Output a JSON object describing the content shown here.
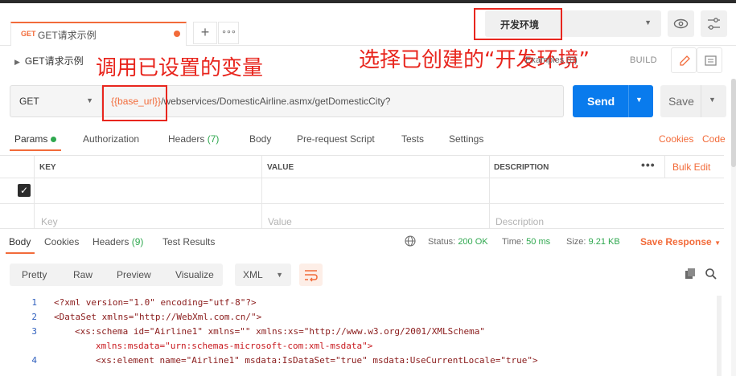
{
  "tab": {
    "method": "GET",
    "name": "GET请求示例"
  },
  "environment": {
    "selected": "开发环境"
  },
  "request": {
    "title": "GET请求示例",
    "examples_label": "Examples",
    "examples_count": "0",
    "build_label": "BUILD",
    "method": "GET",
    "url_var": "{{base_url}}",
    "url_rest": "/webservices/DomesticAirline.asmx/getDomesticCity?",
    "send_label": "Send",
    "save_label": "Save"
  },
  "annotations": {
    "left": "调用已设置的变量",
    "right": "选择已创建的“开发环境”"
  },
  "request_tabs": {
    "params": "Params",
    "authorization": "Authorization",
    "headers": "Headers",
    "headers_count": "(7)",
    "body": "Body",
    "prerequest": "Pre-request Script",
    "tests": "Tests",
    "settings": "Settings",
    "cookies": "Cookies",
    "code": "Code"
  },
  "params_table": {
    "columns": [
      "KEY",
      "VALUE",
      "DESCRIPTION"
    ],
    "bulk_edit": "Bulk Edit",
    "placeholders": {
      "key": "Key",
      "value": "Value",
      "description": "Description"
    }
  },
  "response": {
    "tabs": {
      "body": "Body",
      "cookies": "Cookies",
      "headers": "Headers",
      "headers_count": "(9)",
      "test_results": "Test Results"
    },
    "status_label": "Status:",
    "status_value": "200 OK",
    "time_label": "Time:",
    "time_value": "50 ms",
    "size_label": "Size:",
    "size_value": "9.21 KB",
    "save_response": "Save Response",
    "view_modes": [
      "Pretty",
      "Raw",
      "Preview",
      "Visualize"
    ],
    "format": "XML"
  },
  "code_lines": {
    "n1": "1",
    "n2": "2",
    "n3": "3",
    "n4": "4",
    "l1": "<?xml version=\"1.0\" encoding=\"utf-8\"?>",
    "l2": "<DataSet xmlns=\"http://WebXml.com.cn/\">",
    "l3a": "<xs:schema id=\"Airline1\" xmlns=\"\" xmlns:xs=\"http://www.w3.org/2001/XMLSchema\"",
    "l3b": "xmlns:msdata=\"urn:schemas-microsoft-com:xml-msdata\">",
    "l4": "<xs:element name=\"Airline1\" msdata:IsDataSet=\"true\" msdata:UseCurrentLocale=\"true\">"
  },
  "colors": {
    "accent": "#f26b3a",
    "send": "#097bed",
    "success": "#2fa84f",
    "annotation": "#e8261e"
  }
}
